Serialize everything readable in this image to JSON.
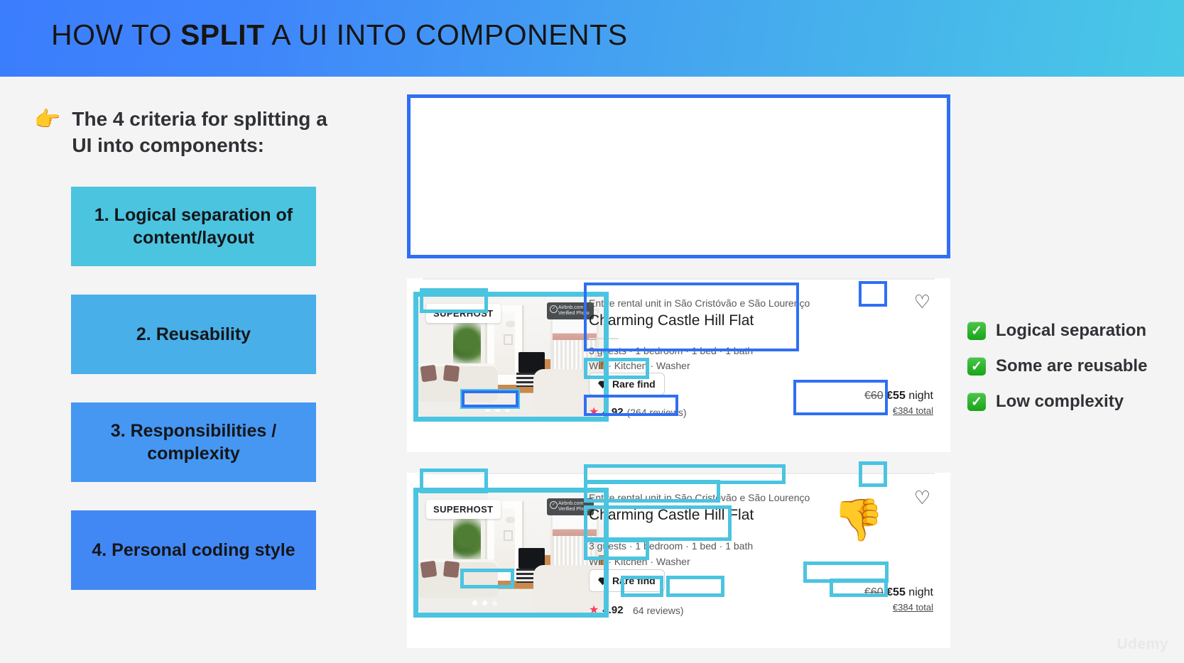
{
  "header": {
    "title_prefix": "HOW TO ",
    "title_bold": "SPLIT",
    "title_suffix": " A UI INTO COMPONENTS",
    "gradient_from": "#3b7dfd",
    "gradient_to": "#49c9e6"
  },
  "sidebar": {
    "pointer_icon": "pointing-right-hand",
    "intro": "The 4 criteria for splitting a UI into components:",
    "criteria": [
      {
        "label": "1. Logical separation of content/layout",
        "color": "#4bc4e0"
      },
      {
        "label": "2. Reusability",
        "color": "#49afe8"
      },
      {
        "label": "3. Responsibilities / complexity",
        "color": "#4597f2"
      },
      {
        "label": "4. Personal coding style",
        "color": "#4288f5"
      }
    ]
  },
  "checklist": {
    "check_icon": "white-heavy-check-mark",
    "items": [
      "Logical separation",
      "Some are reusable",
      "Low complexity"
    ]
  },
  "listing": {
    "superhost_badge": "SUPERHOST",
    "verified_line1": "Airbnb.com",
    "verified_line2": "Verified Photo",
    "subtitle": "Entire rental unit in São Cristóvão e São Lourenço",
    "title": "Charming Castle Hill Flat",
    "specs": "3 guests · 1 bedroom · 1 bed · 1 bath",
    "amenities": "Wifi · Kitchen · Washer",
    "rare_find": "Rare find",
    "rare_find_icon": "gem-icon",
    "rating_star_icon": "star-icon",
    "rating_value": "4.92",
    "rating_count": "(264 reviews)",
    "rating_count_clipped": "64 reviews)",
    "price_old": "€60",
    "price_new": "€55",
    "price_unit": " night",
    "price_total": "€384 total",
    "heart_icon": "heart-outline-icon",
    "thumbs_icon": "thumbs-down"
  },
  "annotations": {
    "blue": "#2f6ff3",
    "cyan": "#4bc4e0"
  },
  "watermark": "Udemy"
}
